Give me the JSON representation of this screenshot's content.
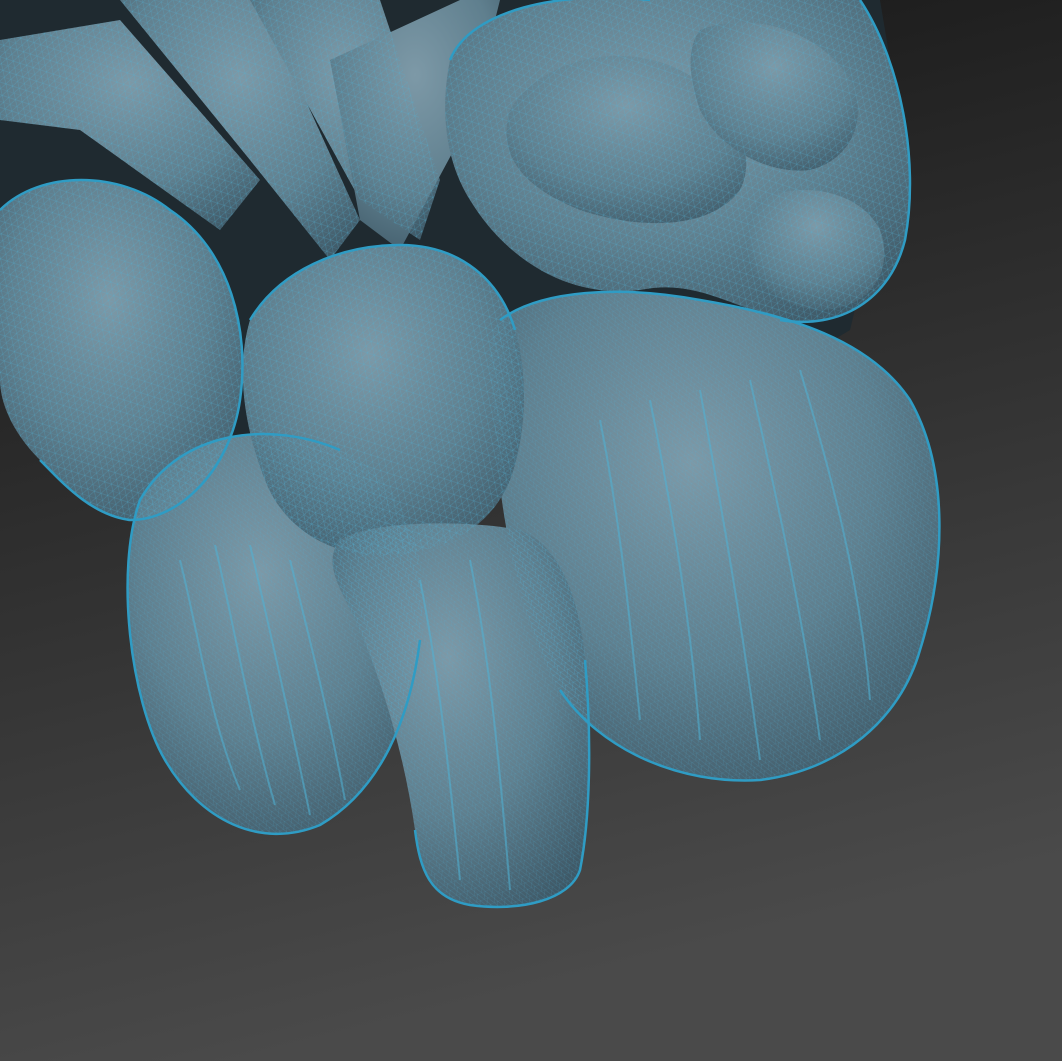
{
  "scene": {
    "subject": "brain-mesh-wireframe",
    "colors": {
      "background_top": "#141414",
      "background_bottom": "#4a4a4a",
      "mesh_fill_light": "#7d99a7",
      "mesh_fill_mid": "#5f7f8e",
      "mesh_fill_dark": "#3e5866",
      "wire": "#4fb3d6",
      "wire_edge": "#2f9cc4",
      "shadow": "#1f2a30"
    }
  }
}
